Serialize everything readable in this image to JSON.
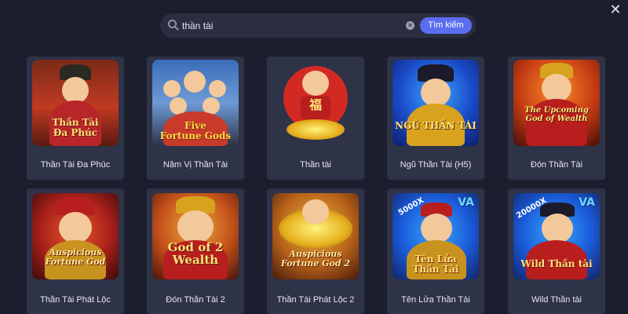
{
  "search": {
    "value": "thần tài",
    "button_label": "Tìm kiếm"
  },
  "games": [
    {
      "name": "Thần Tài Đa Phúc",
      "thumb_title": "Thần Tài\nĐa Phúc"
    },
    {
      "name": "Năm Vị Thần Tài",
      "thumb_title": "Five\nFortune Gods"
    },
    {
      "name": "Thần tài",
      "thumb_title": "福"
    },
    {
      "name": "Ngũ Thần Tài (H5)",
      "thumb_title": "NGŨ THẦN TÀI"
    },
    {
      "name": "Đón Thần Tài",
      "thumb_title": "The Upcoming\nGod of Wealth"
    },
    {
      "name": "Thần Tài Phát Lộc",
      "thumb_title": "Auspicious\nFortune God"
    },
    {
      "name": "Đón Thần Tài 2",
      "thumb_title": "God of 2\nWealth"
    },
    {
      "name": "Thần Tài Phát Lộc 2",
      "thumb_title": "Auspicious\nFortune God 2"
    },
    {
      "name": "Tên Lửa Thần Tài",
      "thumb_title": "Tên Lửa\nThần Tài",
      "multiplier": "5000X",
      "badge": "VA"
    },
    {
      "name": "Wild Thần tài",
      "thumb_title": "Wild Thần tài",
      "multiplier": "20000X",
      "badge": "VA"
    }
  ],
  "colors": {
    "background": "#1b1e2c",
    "card": "#2e3347",
    "search_bar": "#2a2e40",
    "accent": "#5b6df0"
  },
  "icons": {
    "close": "close-icon",
    "search": "search-icon",
    "clear": "clear-icon"
  }
}
